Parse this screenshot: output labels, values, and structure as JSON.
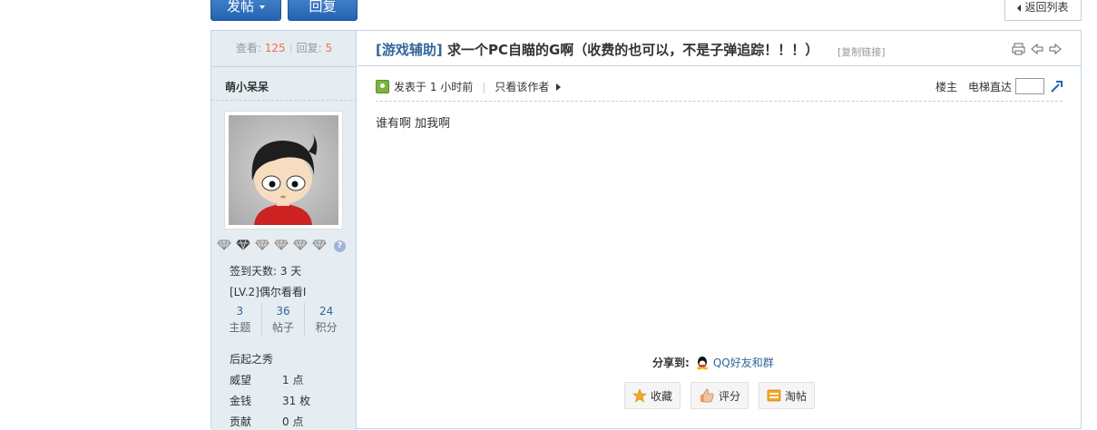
{
  "toolbar": {
    "post_label": "发帖",
    "reply_label": "回复",
    "back_label": "返回列表"
  },
  "stats": {
    "views_label": "查看:",
    "views": "125",
    "replies_label": "回复:",
    "replies": "5"
  },
  "author": {
    "name": "萌小呆呆",
    "signin_days": "签到天数: 3 天",
    "level": "[LV.2]偶尔看看I",
    "counts": [
      {
        "value": "3",
        "label": "主题"
      },
      {
        "value": "36",
        "label": "帖子"
      },
      {
        "value": "24",
        "label": "积分"
      }
    ],
    "rank": "后起之秀",
    "props": [
      {
        "key": "威望",
        "value": "1 点"
      },
      {
        "key": "金钱",
        "value": "31 枚"
      },
      {
        "key": "贡献",
        "value": "0 点"
      }
    ]
  },
  "thread": {
    "category": "[游戏辅助]",
    "title": "求一个PC自瞄的G啊（收费的也可以，不是子弹追踪！！！）",
    "copy_link": "[复制链接]"
  },
  "post": {
    "posted_at": "发表于 1 小时前",
    "only_author": "只看该作者",
    "floor_label": "楼主",
    "jump_label": "电梯直达",
    "body": "谁有啊 加我啊",
    "share_label": "分享到:",
    "share_qq": "QQ好友和群",
    "actions": {
      "favorite": "收藏",
      "rate": "评分",
      "tao": "淘帖"
    }
  },
  "colors": {
    "accent": "#336699",
    "button_blue": "#2363b1",
    "highlight": "#f26c4f",
    "sidebar_bg": "#e5edf2",
    "border": "#c2d5e3"
  }
}
